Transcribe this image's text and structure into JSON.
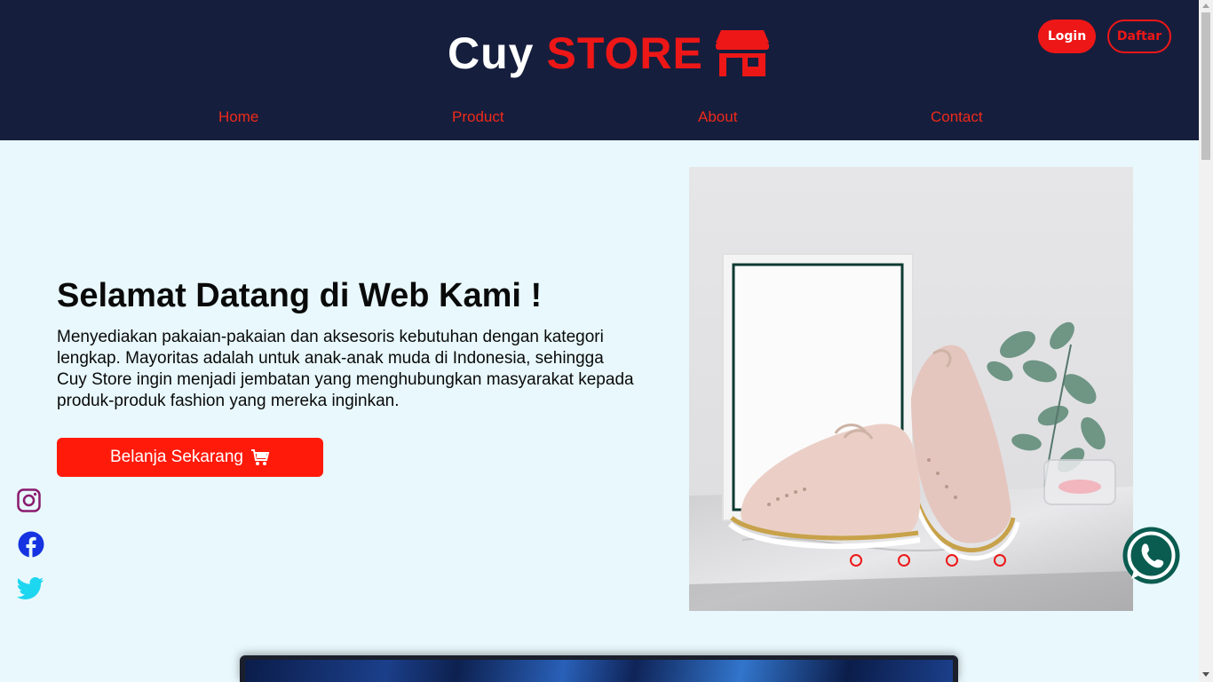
{
  "brand": {
    "part1": "Cuy",
    "part2": "STORE",
    "icon": "store-icon"
  },
  "auth": {
    "login": "Login",
    "register": "Daftar"
  },
  "nav": {
    "home": "Home",
    "product": "Product",
    "about": "About",
    "contact": "Contact"
  },
  "hero": {
    "title": "Selamat Datang di Web Kami !",
    "description": "Menyediakan pakaian-pakaian dan aksesoris kebutuhan dengan kategori lengkap. Mayoritas adalah untuk anak-anak muda di Indonesia, sehingga Cuy Store ingin menjadi jembatan yang menghubungkan masyarakat kepada produk-produk fashion yang mereka inginkan.",
    "cta": "Belanja Sekarang",
    "cta_icon": "cart-icon"
  },
  "social": [
    "instagram-icon",
    "facebook-icon",
    "twitter-icon"
  ],
  "carousel": {
    "slide_count": 4,
    "active_index": 0
  },
  "colors": {
    "header_bg": "#161e3d",
    "accent": "#ee1717",
    "page_bg": "#e8f8fc",
    "instagram": "#8a1a6e",
    "facebook": "#1533e0",
    "twitter": "#1dd6f0",
    "whatsapp": "#0a5c50"
  }
}
